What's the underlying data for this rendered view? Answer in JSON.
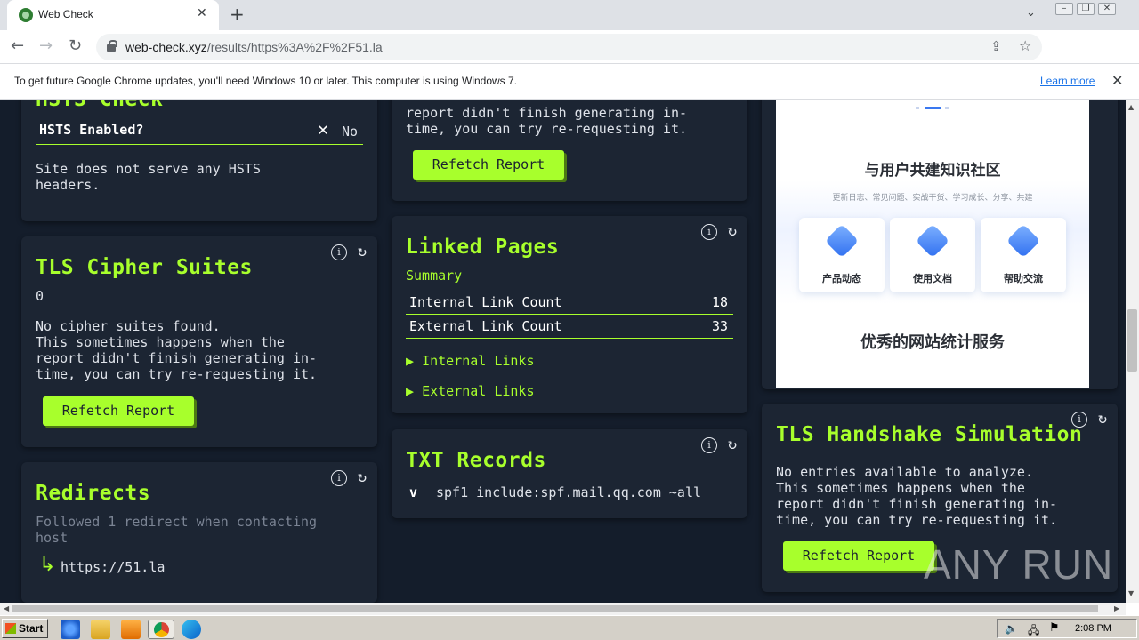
{
  "browser": {
    "tab_title": "Web Check",
    "tab_close": "✕",
    "new_tab": "+",
    "url_host": "web-check.xyz",
    "url_path": "/results/https%3A%2F%2F51.la",
    "infobar_message": "To get future Google Chrome updates, you'll need Windows 10 or later. This computer is using Windows 7.",
    "infobar_link": "Learn more"
  },
  "hsts": {
    "title": "HSTS Check",
    "row_label": "HSTS Enabled?",
    "row_value": "No",
    "description": "Site does not serve any HSTS\nheaders."
  },
  "tls_cipher": {
    "title": "TLS Cipher Suites",
    "count": "0",
    "message": "No cipher suites found.\nThis sometimes happens when the\nreport didn't finish generating in-\ntime, you can try re-requesting it.",
    "button": "Refetch Report"
  },
  "redirects": {
    "title": "Redirects",
    "summary": "Followed 1 redirect when contacting\nhost",
    "target": "https://51.la"
  },
  "top_middle": {
    "message": "report didn't finish generating in-\ntime, you can try re-requesting it.",
    "button": "Refetch Report"
  },
  "linked_pages": {
    "title": "Linked Pages",
    "summary_label": "Summary",
    "rows": [
      {
        "label": "Internal Link Count",
        "value": "18"
      },
      {
        "label": "External Link Count",
        "value": "33"
      }
    ],
    "internal_links": "Internal Links",
    "external_links": "External Links"
  },
  "txt_records": {
    "title": "TXT Records",
    "key": "v",
    "value": "spf1 include:spf.mail.qq.com ~all"
  },
  "embed": {
    "heading": "与用户共建知识社区",
    "subheading": "更新日志、常见问题、实战干货、学习成长、分享、共建",
    "features": [
      "产品动态",
      "使用文档",
      "帮助交流"
    ],
    "footer_heading": "优秀的网站统计服务"
  },
  "tls_handshake": {
    "title": "TLS Handshake Simulation",
    "message": "No entries available to analyze.\nThis sometimes happens when the\nreport didn't finish generating in-\ntime, you can try re-requesting it.",
    "button": "Refetch Report"
  },
  "watermark": "ANY RUN",
  "taskbar": {
    "start": "Start",
    "clock": "2:08 PM"
  },
  "colors": {
    "accent": "#a8ff2c",
    "background": "#141d2b",
    "card": "#1c2533"
  }
}
